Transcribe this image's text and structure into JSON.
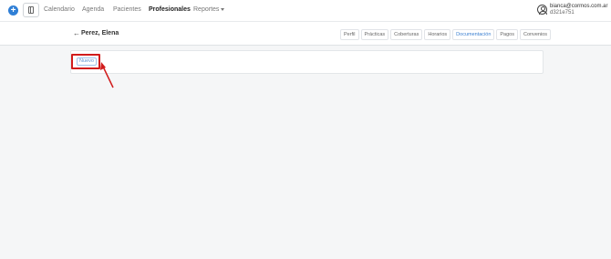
{
  "topnav": {
    "items": [
      {
        "label": "Calendario"
      },
      {
        "label": "Agenda"
      },
      {
        "label": "Pacientes"
      },
      {
        "label": "Profesionales"
      },
      {
        "label": "Reportes"
      }
    ],
    "user": {
      "email": "bianca@cormos.com.ar",
      "id": "d321e751"
    }
  },
  "subheader": {
    "title": "Perez, Elena",
    "tabs": [
      {
        "label": "Perfil"
      },
      {
        "label": "Prácticas"
      },
      {
        "label": "Coberturas"
      },
      {
        "label": "Horarios"
      },
      {
        "label": "Documentación"
      },
      {
        "label": "Pagos"
      },
      {
        "label": "Convenios"
      }
    ]
  },
  "content": {
    "new_button_label": "Nuevo"
  },
  "icons": {
    "plus": "plus-icon",
    "sidebar_toggle": "sidebar-toggle-icon",
    "user": "user-circle-icon",
    "back": "arrow-left-icon"
  },
  "colors": {
    "accent": "#2f7fd6",
    "annotation": "#d11c1c"
  }
}
